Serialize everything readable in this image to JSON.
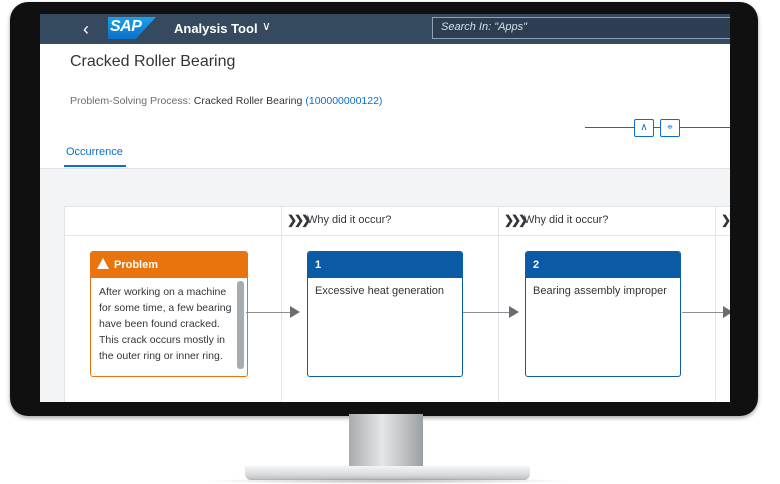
{
  "shell": {
    "back_icon": "chevron-left-icon",
    "logo_text": "SAP",
    "app_title": "Analysis Tool",
    "search_placeholder": "Search In: \"Apps\""
  },
  "header": {
    "title": "Cracked Roller Bearing",
    "process_label": "Problem-Solving Process:",
    "process_name": "Cracked Roller Bearing",
    "process_id": "(100000000122)"
  },
  "tabs": [
    {
      "label": "Occurrence",
      "selected": true
    }
  ],
  "analysis": {
    "column_headers": [
      "Why did it occur?",
      "Why did it occur?"
    ],
    "problem": {
      "title": "Problem",
      "icon": "warning-icon",
      "text": "After working on a machine for some time, a few bearing have been found cracked. This crack occurs mostly in the outer ring or inner ring."
    },
    "causes": [
      {
        "number": "1",
        "text": "Excessive heat generation"
      },
      {
        "number": "2",
        "text": "Bearing assembly improper"
      }
    ]
  },
  "colors": {
    "shell": "#354a5f",
    "accent": "#0a6ed1",
    "problem": "#e9730c",
    "cause_header": "#0a5aa6"
  }
}
